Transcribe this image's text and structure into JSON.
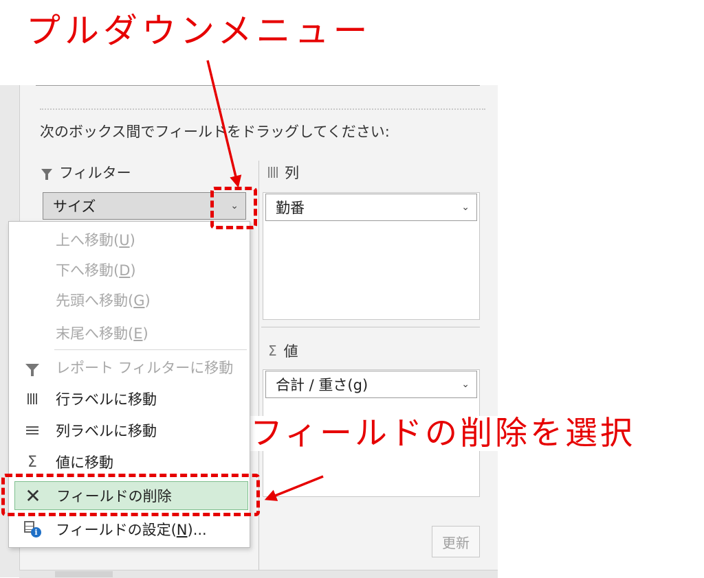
{
  "annotations": {
    "top_callout": "プルダウンメニュー",
    "middle_callout": "フィールドの削除を選択",
    "accent_color": "#e60000"
  },
  "pane": {
    "instructions": "次のボックス間でフィールドをドラッグしてください:",
    "filter_area": {
      "icon": "filter-icon",
      "title": "フィルター",
      "field": "サイズ"
    },
    "columns_area": {
      "icon": "columns-icon",
      "title": "列",
      "field": "勤番"
    },
    "values_area": {
      "icon": "sigma-icon",
      "title": "値",
      "field": "合計 / 重さ(g)"
    },
    "update_button": "更新"
  },
  "context_menu": {
    "items": [
      {
        "label": "上へ移動(U)",
        "enabled": false,
        "icon": ""
      },
      {
        "label": "下へ移動(D)",
        "enabled": false,
        "icon": ""
      },
      {
        "label": "先頭へ移動(G)",
        "enabled": false,
        "icon": ""
      },
      {
        "label": "末尾へ移動(E)",
        "enabled": false,
        "icon": ""
      },
      {
        "label": "レポート フィルターに移動",
        "enabled": false,
        "icon": "filter-icon"
      },
      {
        "label": "行ラベルに移動",
        "enabled": true,
        "icon": "row-labels-icon"
      },
      {
        "label": "列ラベルに移動",
        "enabled": true,
        "icon": "column-labels-icon"
      },
      {
        "label": "値に移動",
        "enabled": true,
        "icon": "sigma-icon"
      },
      {
        "label": "フィールドの削除",
        "enabled": true,
        "icon": "remove-x-icon",
        "highlighted": true
      },
      {
        "label": "フィールドの設定(N)...",
        "enabled": true,
        "icon": "field-settings-icon"
      }
    ],
    "highlight_color": "#d4ecd9"
  }
}
